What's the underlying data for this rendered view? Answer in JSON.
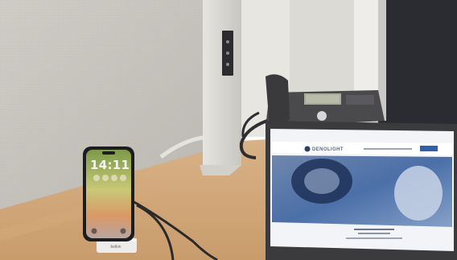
{
  "phone": {
    "time": "14:11"
  },
  "laptop": {
    "brand": "DENOLIGHT"
  },
  "stand": {
    "brand": "belkin"
  }
}
